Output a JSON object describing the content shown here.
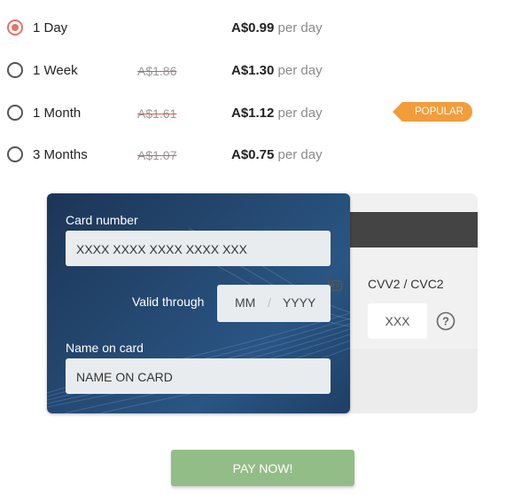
{
  "plans": [
    {
      "label": "1 Day",
      "old_price": "",
      "price": "A$0.99",
      "per": "per day",
      "selected": true
    },
    {
      "label": "1 Week",
      "old_price": "A$1.86",
      "price": "A$1.30",
      "per": "per day",
      "selected": false
    },
    {
      "label": "1 Month",
      "old_price": "A$1.61",
      "price": "A$1.12",
      "per": "per day",
      "selected": false
    },
    {
      "label": "3 Months",
      "old_price": "A$1.07",
      "price": "A$0.75",
      "per": "per day",
      "selected": false
    }
  ],
  "popular_badge": "POPULAR",
  "card": {
    "number_label": "Card number",
    "number_placeholder": "XXXX XXXX XXXX XXXX XXX",
    "valid_label": "Valid through",
    "month_placeholder": "MM",
    "separator": "/",
    "year_placeholder": "YYYY",
    "name_label": "Name on card",
    "name_placeholder": "NAME ON CARD",
    "cvv_label": "CVV2 / CVC2",
    "cvv_placeholder": "XXX"
  },
  "pay_button": "PAY NOW!",
  "colors": {
    "selected_radio": "#e57368",
    "popular_badge": "#f39c3a",
    "pay_button": "#93bd86",
    "card_front": "#254a73"
  },
  "icons": [
    "radio-selected-icon",
    "radio-icon",
    "card-id-icon",
    "question-circle-icon"
  ]
}
